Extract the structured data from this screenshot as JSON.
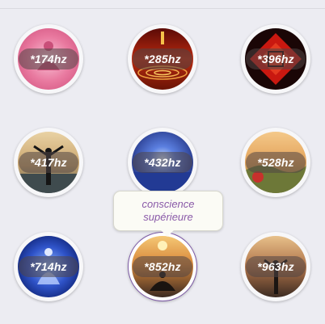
{
  "frequencies": [
    {
      "label": "*174hz",
      "theme": "pink-meditation"
    },
    {
      "label": "*285hz",
      "theme": "fire-ripple"
    },
    {
      "label": "*396hz",
      "theme": "red-pattern"
    },
    {
      "label": "*417hz",
      "theme": "sunset-figure"
    },
    {
      "label": "*432hz",
      "theme": "blue-light"
    },
    {
      "label": "*528hz",
      "theme": "valley-sunset"
    },
    {
      "label": "*714hz",
      "theme": "blue-chakra"
    },
    {
      "label": "*852hz",
      "theme": "golden-meditation"
    },
    {
      "label": "*963hz",
      "theme": "dusk-figure"
    }
  ],
  "tooltip": {
    "line1": "conscience",
    "line2": "supérieure"
  },
  "active_index": 7,
  "colors": {
    "background": "#ececf2",
    "tooltip_text": "#8a5aa8",
    "active_border": "#7d5aa6"
  }
}
